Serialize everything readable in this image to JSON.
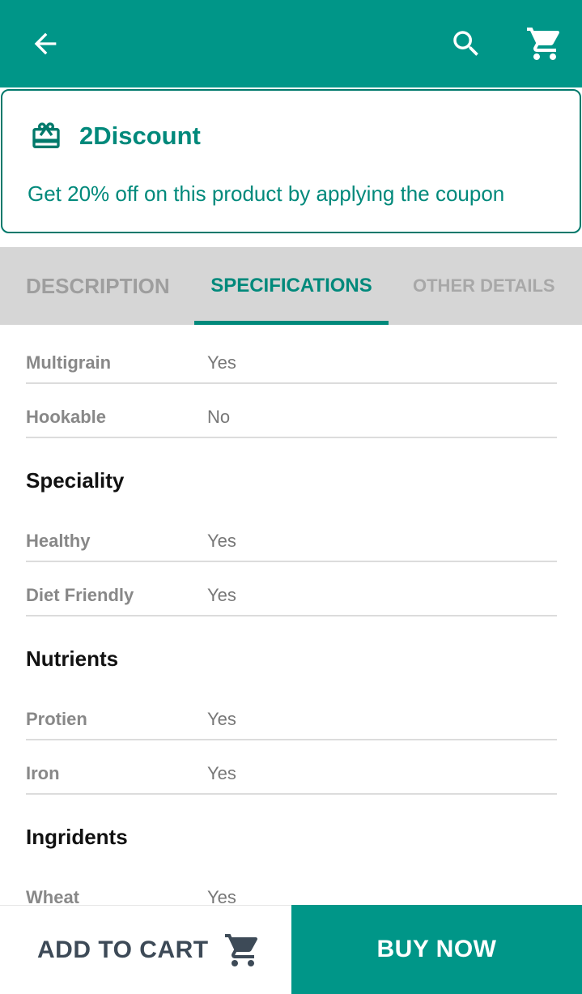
{
  "appbar": {
    "back_icon": "arrow-back-icon",
    "search_icon": "search-icon",
    "cart_icon": "shopping-cart-icon",
    "color": "#009688"
  },
  "coupon": {
    "icon": "gift-card-icon",
    "title": "2Discount",
    "description": "Get 20% off on this product by applying the coupon",
    "accent": "#00897b"
  },
  "tabs": [
    {
      "label": "DESCRIPTION",
      "active": false
    },
    {
      "label": "SPECIFICATIONS",
      "active": true
    },
    {
      "label": "OTHER DETAILS",
      "active": false
    }
  ],
  "specs": {
    "general": [
      {
        "key": "Multigrain",
        "value": "Yes"
      },
      {
        "key": "Hookable",
        "value": "No"
      }
    ],
    "speciality": {
      "heading": "Speciality",
      "items": [
        {
          "key": "Healthy",
          "value": "Yes"
        },
        {
          "key": "Diet Friendly",
          "value": "Yes"
        }
      ]
    },
    "nutrients": {
      "heading": "Nutrients",
      "items": [
        {
          "key": "Protien",
          "value": "Yes"
        },
        {
          "key": "Iron",
          "value": "Yes"
        }
      ]
    },
    "ingridents": {
      "heading": "Ingridents",
      "items": [
        {
          "key": "Wheat",
          "value": "Yes"
        }
      ]
    }
  },
  "bottom": {
    "add_to_cart": "ADD TO CART",
    "add_to_cart_icon": "shopping-cart-icon",
    "buy_now": "BUY NOW"
  }
}
